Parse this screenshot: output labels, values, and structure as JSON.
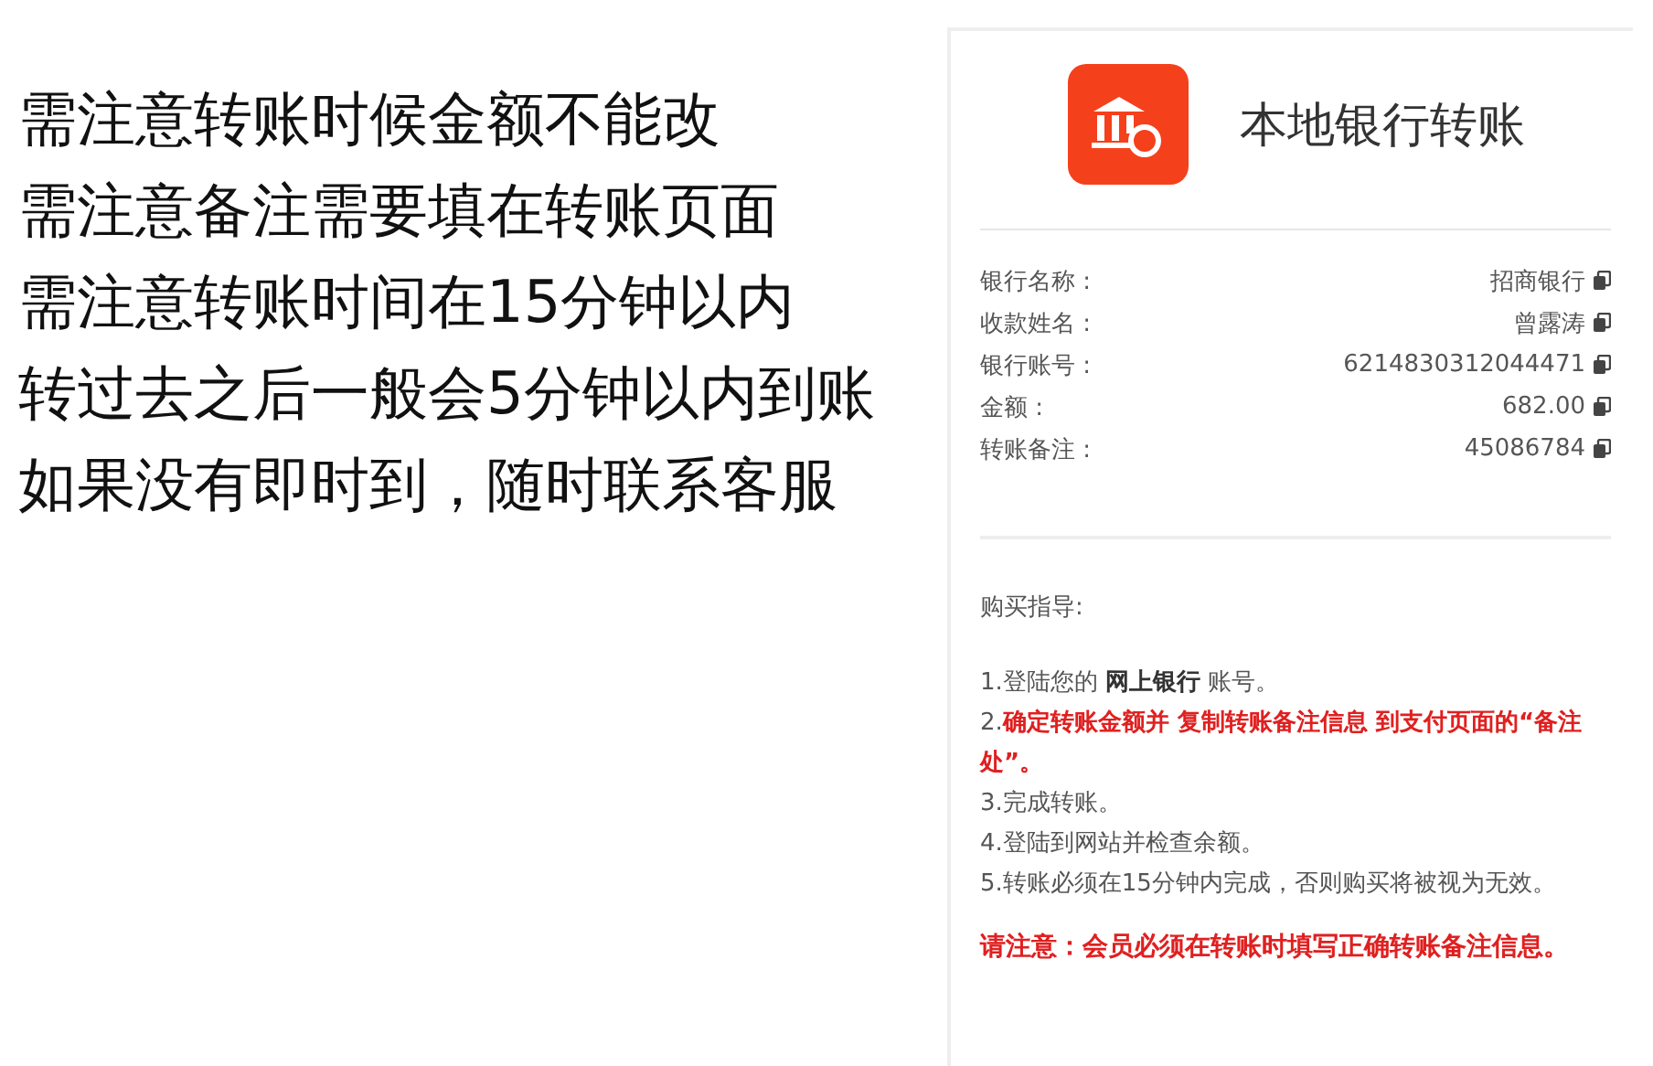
{
  "notes": [
    "需注意转账时候金额不能改",
    "需注意备注需要填在转账页面",
    "需注意转账时间在15分钟以内",
    "转过去之后一般会5分钟以内到账",
    "如果没有即时到，随时联系客服"
  ],
  "panel": {
    "title": "本地银行转账",
    "details": [
      {
        "label": "银行名称 :",
        "value": "招商银行"
      },
      {
        "label": "收款姓名 :",
        "value": "曾露涛"
      },
      {
        "label": "银行账号 :",
        "value": "6214830312044471"
      },
      {
        "label": "金额 :",
        "value": "682.00"
      },
      {
        "label": "转账备注 :",
        "value": "45086784"
      }
    ],
    "guide_heading": "购买指导:",
    "steps": [
      {
        "number": "1.",
        "text": "登陆您的 **网上银行** 账号。",
        "kind": "normal"
      },
      {
        "number": "2.",
        "text": "确定转账金额并 复制转账备注信息 到支付页面的“备注处”。",
        "kind": "highlight"
      },
      {
        "number": "3.",
        "text": "完成转账。",
        "kind": "normal"
      },
      {
        "number": "4.",
        "text": "登陆到网站并检查余额。",
        "kind": "normal"
      },
      {
        "number": "5.",
        "text": "转账必须在15分钟内完成，否则购买将被视为无效。",
        "kind": "normal"
      }
    ],
    "notice": "请注意：会员必须在转账时填写正确转账备注信息。"
  }
}
